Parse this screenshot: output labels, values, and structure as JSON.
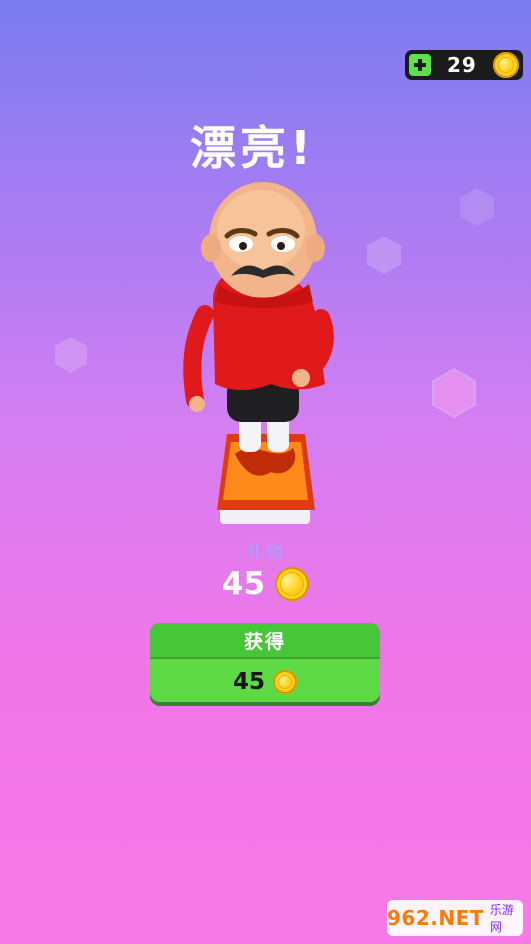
{
  "header": {
    "coins": "29"
  },
  "title": "漂亮!",
  "reward": {
    "label": "礼物",
    "amount": "45"
  },
  "action_button": {
    "label": "获得",
    "amount": "45"
  },
  "watermark": {
    "brand": "962.NET",
    "sub": "乐游网"
  },
  "colors": {
    "accent_green": "#46c638",
    "coin_gold": "#ffd21f",
    "counter_bg": "#1b1b1b"
  },
  "icons": [
    "plus-icon",
    "coin-icon"
  ]
}
